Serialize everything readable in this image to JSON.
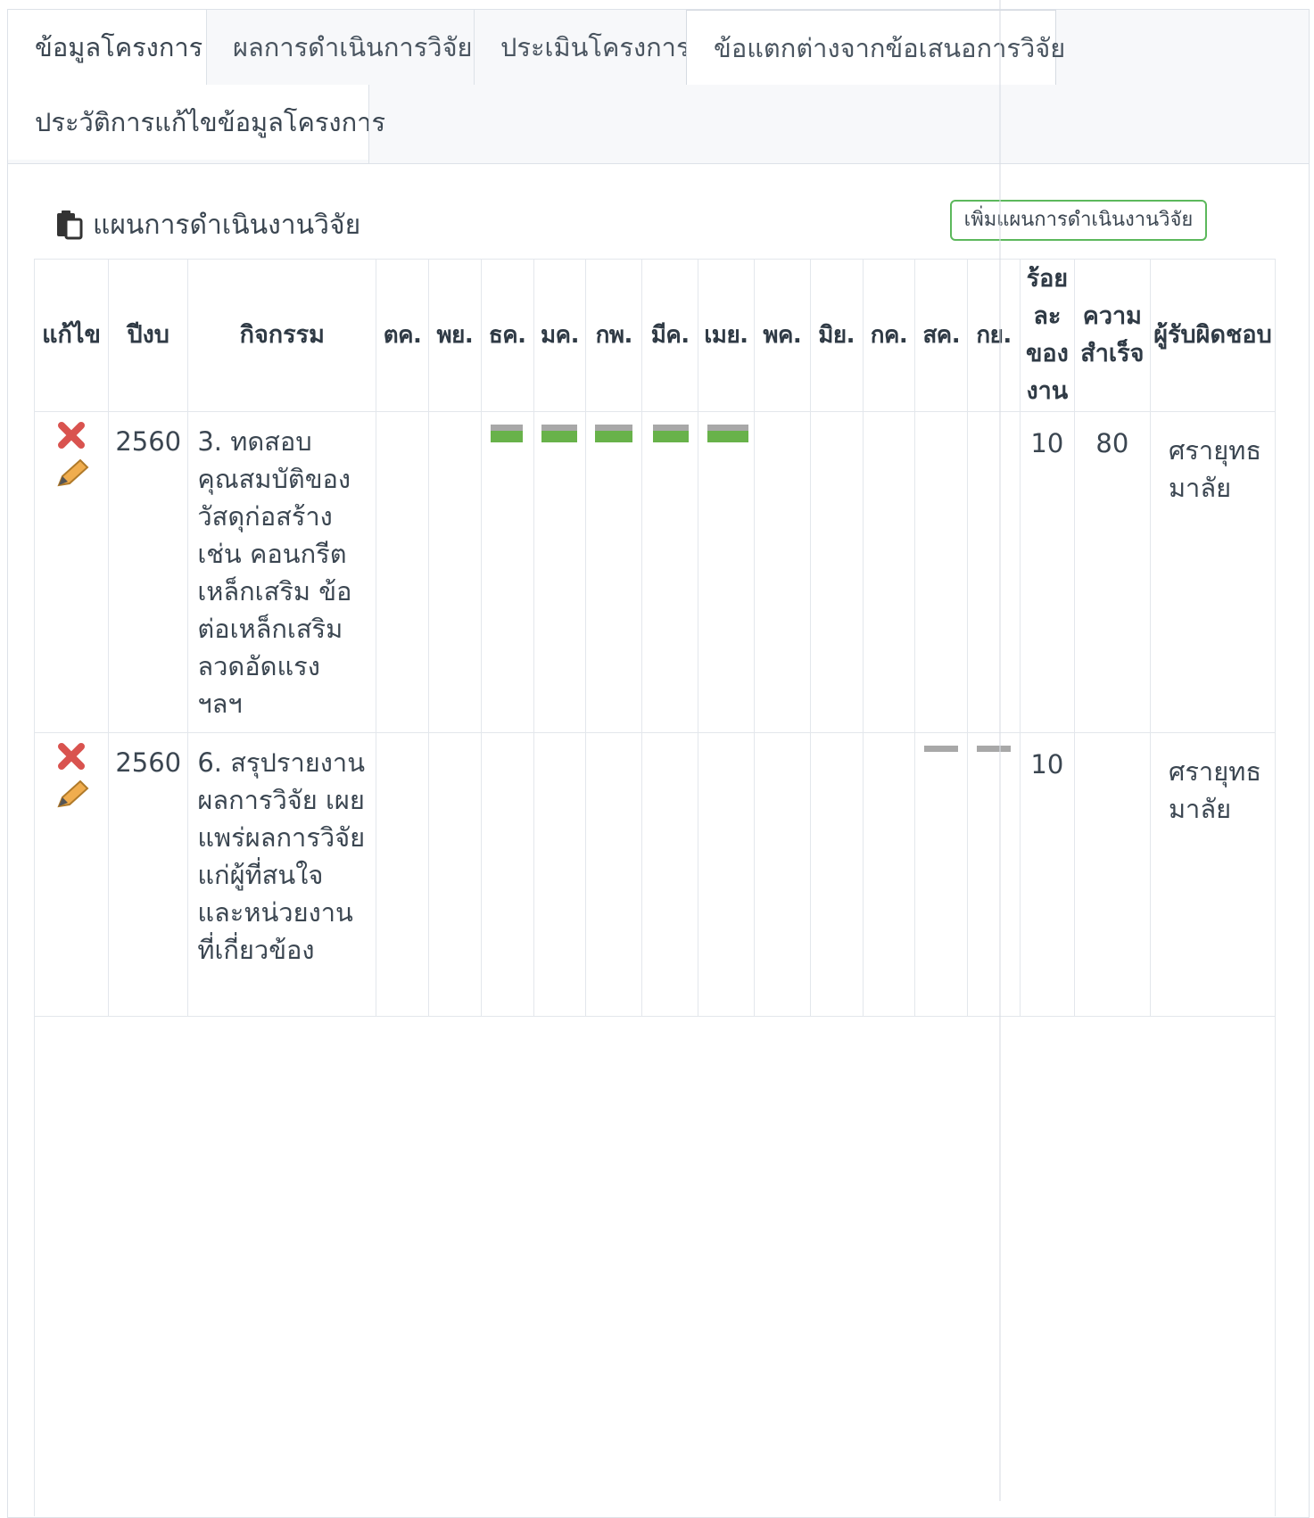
{
  "tabs": [
    {
      "label": "ข้อมูลโครงการ"
    },
    {
      "label": "ผลการดำเนินการวิจัย"
    },
    {
      "label": "ประเมินโครงการ"
    },
    {
      "label": "ข้อแตกต่างจากข้อเสนอการวิจัย"
    },
    {
      "label": "ประวัติการแก้ไขข้อมูลโครงการ"
    }
  ],
  "section": {
    "title": "แผนการดำเนินงานวิจัย",
    "icon": "clipboard-icon",
    "add_button_label": "เพิ่มแผนการดำเนินงานวิจัย"
  },
  "table": {
    "headers": {
      "edit": "แก้ไข",
      "year": "ปีงบ",
      "activity": "กิจกรรม",
      "months": [
        "ตค.",
        "พย.",
        "ธค.",
        "มค.",
        "กพ.",
        "มีค.",
        "เมย.",
        "พค.",
        "มิย.",
        "กค.",
        "สค.",
        "กย."
      ],
      "percent": "ร้อยละของงาน",
      "success": "ความสำเร็จ",
      "responsible": "ผู้รับผิดชอบ"
    },
    "rows": [
      {
        "year": "2560",
        "activity": "3. ทดสอบคุณสมบัติของวัสดุก่อสร้าง เช่น คอนกรีต เหล็กเสริม ข้อต่อเหล็กเสริม ลวดอัดแรง ฯลฯ",
        "percent": "10",
        "success": "80",
        "responsible": "ศรายุทธ มาลัย",
        "month_marks": [
          {
            "month": "ธค.",
            "status": "done"
          },
          {
            "month": "มค.",
            "status": "done"
          },
          {
            "month": "กพ.",
            "status": "done"
          },
          {
            "month": "มีค.",
            "status": "done"
          },
          {
            "month": "เมย.",
            "status": "done"
          }
        ]
      },
      {
        "year": "2560",
        "activity": "6. สรุปรายงานผลการวิจัย เผยแพร่ผลการวิจัยแก่ผู้ที่สนใจและหน่วยงานที่เกี่ยวข้อง",
        "percent": "10",
        "success": "",
        "responsible": "ศรายุทธ มาลัย",
        "month_marks": [
          {
            "month": "สค.",
            "status": "planned"
          },
          {
            "month": "กย.",
            "status": "planned"
          }
        ]
      }
    ]
  },
  "colors": {
    "bar_done": "#68b24a",
    "bar_planned": "#a8a8a8",
    "button_border": "#5cb85c",
    "delete_icon": "#d9534f"
  }
}
